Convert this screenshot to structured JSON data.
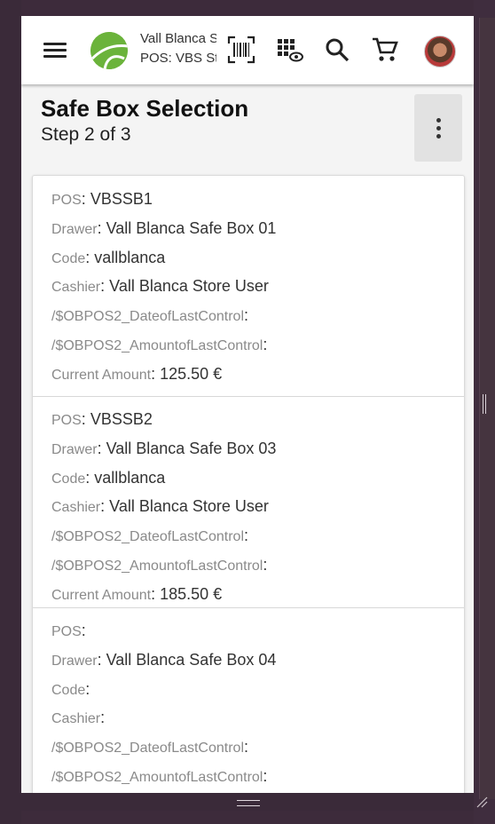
{
  "app": {
    "store_name": "Vall Blanca Store",
    "pos_label": "POS: VBS Store"
  },
  "header": {
    "title": "Safe Box Selection",
    "step": "Step 2 of 3"
  },
  "labels": {
    "pos": "POS",
    "drawer": "Drawer",
    "code": "Code",
    "cashier": "Cashier",
    "date_last_control": "/$OBPOS2_DateofLastControl",
    "amount_last_control": "/$OBPOS2_AmountofLastControl",
    "current_amount": "Current Amount"
  },
  "safeboxes": [
    {
      "pos": "VBSSB1",
      "drawer": "Vall Blanca Safe Box 01",
      "code": "vallblanca",
      "cashier": "Vall Blanca Store User",
      "date_last_control": "",
      "amount_last_control": "",
      "current_amount": "125.50 €"
    },
    {
      "pos": "VBSSB2",
      "drawer": "Vall Blanca Safe Box 03",
      "code": "vallblanca",
      "cashier": "Vall Blanca Store User",
      "date_last_control": "",
      "amount_last_control": "",
      "current_amount": "185.50 €"
    },
    {
      "pos": "",
      "drawer": "Vall Blanca Safe Box 04",
      "code": "",
      "cashier": "",
      "date_last_control": "",
      "amount_last_control": "",
      "current_amount": ""
    }
  ],
  "icons": {
    "menu": "menu-icon",
    "logo": "brand-logo-icon",
    "scan": "barcode-scan-icon",
    "grid": "qr-view-icon",
    "search": "search-icon",
    "cart": "cart-icon",
    "more": "more-vert-icon"
  },
  "colors": {
    "brand": "#6bb33b",
    "label": "#8a8a8a",
    "value": "#333333"
  }
}
